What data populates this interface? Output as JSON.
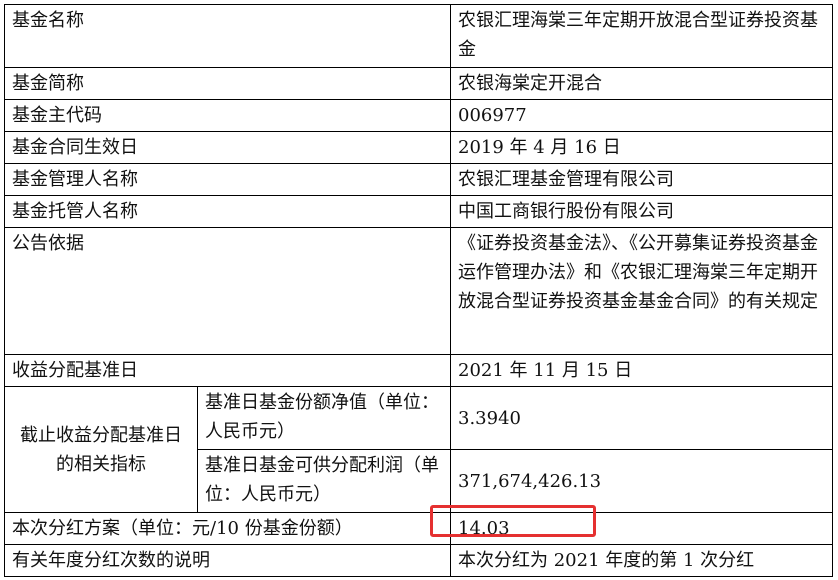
{
  "rows": {
    "fund_name": {
      "label": "基金名称",
      "value": "农银汇理海棠三年定期开放混合型证券投资基金"
    },
    "fund_short": {
      "label": "基金简称",
      "value": "农银海棠定开混合"
    },
    "fund_code": {
      "label": "基金主代码",
      "value": "006977"
    },
    "effective_date": {
      "label": "基金合同生效日",
      "value": "2019 年 4 月 16 日"
    },
    "manager": {
      "label": "基金管理人名称",
      "value": "农银汇理基金管理有限公司"
    },
    "custodian": {
      "label": "基金托管人名称",
      "value": "中国工商银行股份有限公司"
    },
    "basis": {
      "label": "公告依据",
      "value": "《证券投资基金法》、《公开募集证券投资基金运作管理办法》和《农银汇理海棠三年定期开放混合型证券投资基金基金合同》的有关规定"
    },
    "base_date": {
      "label": "收益分配基准日",
      "value": "2021 年 11 月 15 日"
    },
    "indicators": {
      "label": "截止收益分配基准日的相关指标",
      "nav": {
        "label": "基准日基金份额净值（单位：人民币元）",
        "value": "3.3940"
      },
      "distributable": {
        "label": "基准日基金可供分配利润（单位：人民币元）",
        "value": "371,674,426.13"
      }
    },
    "plan": {
      "label": "本次分红方案（单位：元/10 份基金份额）",
      "value": "14.03"
    },
    "annual_note": {
      "label": "有关年度分红次数的说明",
      "value": "本次分红为 2021 年度的第 1 次分红"
    }
  },
  "colors": {
    "highlight": "#e53030",
    "border": "#000000"
  }
}
